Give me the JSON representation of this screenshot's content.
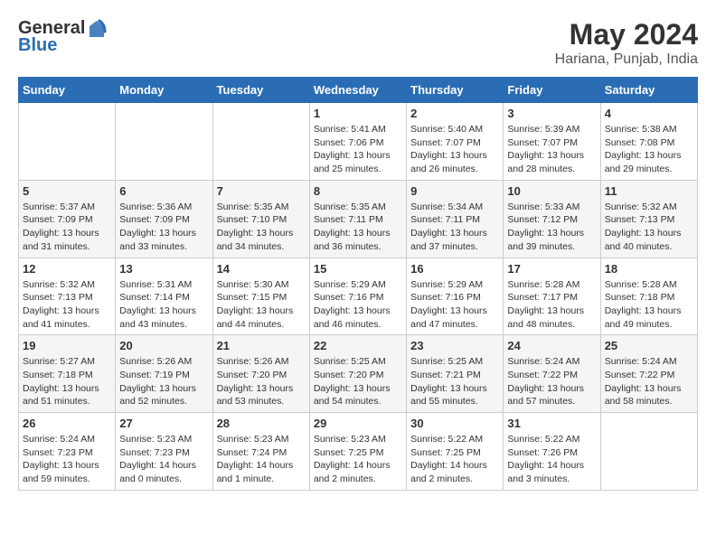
{
  "header": {
    "logo_general": "General",
    "logo_blue": "Blue",
    "title": "May 2024",
    "location": "Hariana, Punjab, India"
  },
  "days_of_week": [
    "Sunday",
    "Monday",
    "Tuesday",
    "Wednesday",
    "Thursday",
    "Friday",
    "Saturday"
  ],
  "weeks": [
    {
      "days": [
        {
          "number": "",
          "info": ""
        },
        {
          "number": "",
          "info": ""
        },
        {
          "number": "",
          "info": ""
        },
        {
          "number": "1",
          "info": "Sunrise: 5:41 AM\nSunset: 7:06 PM\nDaylight: 13 hours\nand 25 minutes."
        },
        {
          "number": "2",
          "info": "Sunrise: 5:40 AM\nSunset: 7:07 PM\nDaylight: 13 hours\nand 26 minutes."
        },
        {
          "number": "3",
          "info": "Sunrise: 5:39 AM\nSunset: 7:07 PM\nDaylight: 13 hours\nand 28 minutes."
        },
        {
          "number": "4",
          "info": "Sunrise: 5:38 AM\nSunset: 7:08 PM\nDaylight: 13 hours\nand 29 minutes."
        }
      ]
    },
    {
      "days": [
        {
          "number": "5",
          "info": "Sunrise: 5:37 AM\nSunset: 7:09 PM\nDaylight: 13 hours\nand 31 minutes."
        },
        {
          "number": "6",
          "info": "Sunrise: 5:36 AM\nSunset: 7:09 PM\nDaylight: 13 hours\nand 33 minutes."
        },
        {
          "number": "7",
          "info": "Sunrise: 5:35 AM\nSunset: 7:10 PM\nDaylight: 13 hours\nand 34 minutes."
        },
        {
          "number": "8",
          "info": "Sunrise: 5:35 AM\nSunset: 7:11 PM\nDaylight: 13 hours\nand 36 minutes."
        },
        {
          "number": "9",
          "info": "Sunrise: 5:34 AM\nSunset: 7:11 PM\nDaylight: 13 hours\nand 37 minutes."
        },
        {
          "number": "10",
          "info": "Sunrise: 5:33 AM\nSunset: 7:12 PM\nDaylight: 13 hours\nand 39 minutes."
        },
        {
          "number": "11",
          "info": "Sunrise: 5:32 AM\nSunset: 7:13 PM\nDaylight: 13 hours\nand 40 minutes."
        }
      ]
    },
    {
      "days": [
        {
          "number": "12",
          "info": "Sunrise: 5:32 AM\nSunset: 7:13 PM\nDaylight: 13 hours\nand 41 minutes."
        },
        {
          "number": "13",
          "info": "Sunrise: 5:31 AM\nSunset: 7:14 PM\nDaylight: 13 hours\nand 43 minutes."
        },
        {
          "number": "14",
          "info": "Sunrise: 5:30 AM\nSunset: 7:15 PM\nDaylight: 13 hours\nand 44 minutes."
        },
        {
          "number": "15",
          "info": "Sunrise: 5:29 AM\nSunset: 7:16 PM\nDaylight: 13 hours\nand 46 minutes."
        },
        {
          "number": "16",
          "info": "Sunrise: 5:29 AM\nSunset: 7:16 PM\nDaylight: 13 hours\nand 47 minutes."
        },
        {
          "number": "17",
          "info": "Sunrise: 5:28 AM\nSunset: 7:17 PM\nDaylight: 13 hours\nand 48 minutes."
        },
        {
          "number": "18",
          "info": "Sunrise: 5:28 AM\nSunset: 7:18 PM\nDaylight: 13 hours\nand 49 minutes."
        }
      ]
    },
    {
      "days": [
        {
          "number": "19",
          "info": "Sunrise: 5:27 AM\nSunset: 7:18 PM\nDaylight: 13 hours\nand 51 minutes."
        },
        {
          "number": "20",
          "info": "Sunrise: 5:26 AM\nSunset: 7:19 PM\nDaylight: 13 hours\nand 52 minutes."
        },
        {
          "number": "21",
          "info": "Sunrise: 5:26 AM\nSunset: 7:20 PM\nDaylight: 13 hours\nand 53 minutes."
        },
        {
          "number": "22",
          "info": "Sunrise: 5:25 AM\nSunset: 7:20 PM\nDaylight: 13 hours\nand 54 minutes."
        },
        {
          "number": "23",
          "info": "Sunrise: 5:25 AM\nSunset: 7:21 PM\nDaylight: 13 hours\nand 55 minutes."
        },
        {
          "number": "24",
          "info": "Sunrise: 5:24 AM\nSunset: 7:22 PM\nDaylight: 13 hours\nand 57 minutes."
        },
        {
          "number": "25",
          "info": "Sunrise: 5:24 AM\nSunset: 7:22 PM\nDaylight: 13 hours\nand 58 minutes."
        }
      ]
    },
    {
      "days": [
        {
          "number": "26",
          "info": "Sunrise: 5:24 AM\nSunset: 7:23 PM\nDaylight: 13 hours\nand 59 minutes."
        },
        {
          "number": "27",
          "info": "Sunrise: 5:23 AM\nSunset: 7:23 PM\nDaylight: 14 hours\nand 0 minutes."
        },
        {
          "number": "28",
          "info": "Sunrise: 5:23 AM\nSunset: 7:24 PM\nDaylight: 14 hours\nand 1 minute."
        },
        {
          "number": "29",
          "info": "Sunrise: 5:23 AM\nSunset: 7:25 PM\nDaylight: 14 hours\nand 2 minutes."
        },
        {
          "number": "30",
          "info": "Sunrise: 5:22 AM\nSunset: 7:25 PM\nDaylight: 14 hours\nand 2 minutes."
        },
        {
          "number": "31",
          "info": "Sunrise: 5:22 AM\nSunset: 7:26 PM\nDaylight: 14 hours\nand 3 minutes."
        },
        {
          "number": "",
          "info": ""
        }
      ]
    }
  ]
}
